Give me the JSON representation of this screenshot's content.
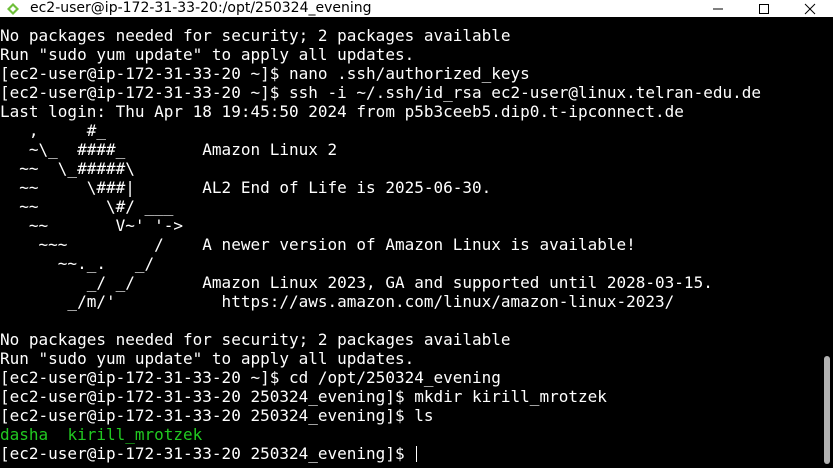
{
  "window": {
    "title": "ec2-user@ip-172-31-33-20:/opt/250324_evening",
    "app_icon": "terminal-app-icon",
    "controls": [
      "minimize-icon",
      "maximize-icon",
      "close-icon"
    ]
  },
  "terminal": {
    "lines": [
      "No packages needed for security; 2 packages available",
      "Run \"sudo yum update\" to apply all updates.",
      "[ec2-user@ip-172-31-33-20 ~]$ nano .ssh/authorized_keys",
      "[ec2-user@ip-172-31-33-20 ~]$ ssh -i ~/.ssh/id_rsa ec2-user@linux.telran-edu.de",
      "Last login: Thu Apr 18 19:45:50 2024 from p5b3ceeb5.dip0.t-ipconnect.de",
      "   ,     #_",
      "   ~\\_  ####_        Amazon Linux 2",
      "  ~~  \\_#####\\",
      "  ~~     \\###|       AL2 End of Life is 2025-06-30.",
      "  ~~       \\#/ ___",
      "   ~~       V~' '->",
      "    ~~~         /    A newer version of Amazon Linux is available!",
      "      ~~._.   _/",
      "         _/ _/       Amazon Linux 2023, GA and supported until 2028-03-15.",
      "       _/m/'           https://aws.amazon.com/linux/amazon-linux-2023/",
      "",
      "No packages needed for security; 2 packages available",
      "Run \"sudo yum update\" to apply all updates.",
      "[ec2-user@ip-172-31-33-20 ~]$ cd /opt/250324_evening",
      "[ec2-user@ip-172-31-33-20 250324_evening]$ mkdir kirill_mrotzek",
      "[ec2-user@ip-172-31-33-20 250324_evening]$ ls"
    ],
    "ls_output": [
      "dasha",
      "kirill_mrotzek"
    ],
    "prompt": "[ec2-user@ip-172-31-33-20 250324_evening]$ ",
    "colors": {
      "background": "#000000",
      "foreground": "#ffffff",
      "directory": "#21c921"
    }
  }
}
